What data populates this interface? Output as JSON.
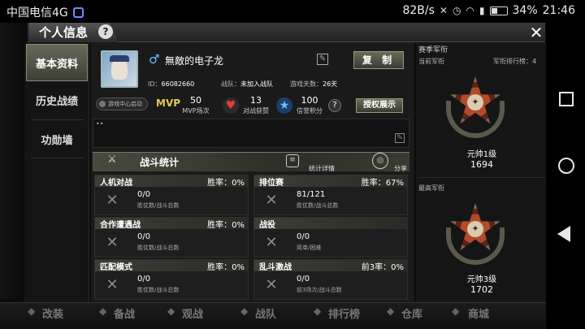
{
  "status_bar": {
    "carrier": "中国电信4G",
    "speed": "82B/s",
    "battery": "34%",
    "time": "21:46",
    "net_small": "4G"
  },
  "window": {
    "title": "个人信息",
    "help": "?",
    "close": "✕"
  },
  "side_menu": {
    "items": [
      {
        "label": "基本资料"
      },
      {
        "label": "历史战绩"
      },
      {
        "label": "功勋墙"
      }
    ]
  },
  "profile": {
    "gender_icon": "♂",
    "nickname": "無敵的电子龙",
    "copy_label": "复 制",
    "id_label": "ID：",
    "id_value": "66082660",
    "team_label": "战队：",
    "team_value": "未加入战队",
    "days_label": "游戏天数：",
    "days_value": "26天",
    "live_label": "游戏中心启动",
    "mvp_badge": "MVP",
    "mvp_value": "50",
    "mvp_label": "MVP场次",
    "likes_value": "13",
    "likes_label": "对战获赞",
    "credit_value": "100",
    "credit_label": "信誉积分",
    "help": "?",
    "auth_label": "授权展示",
    "signature": "••"
  },
  "battle": {
    "title": "战斗统计",
    "detail_label": "统计详情",
    "share_label": "分享",
    "modes": [
      {
        "name": "人机对战",
        "rate": "胜率：0%",
        "value": "0/0",
        "sub": "胜仗数/战斗总数"
      },
      {
        "name": "排位赛",
        "rate": "胜率：67%",
        "value": "81/121",
        "sub": "胜仗数/战斗总数"
      },
      {
        "name": "合作遭遇战",
        "rate": "胜率：0%",
        "value": "0/0",
        "sub": "胜仗数/战斗总数"
      },
      {
        "name": "战役",
        "rate": "",
        "value": "0/0",
        "sub": "简单/困难"
      },
      {
        "name": "匹配模式",
        "rate": "胜率：0%",
        "value": "0/0",
        "sub": "胜仗数/战斗总数"
      },
      {
        "name": "乱斗激战",
        "rate": "前3率：0%",
        "value": "0/0",
        "sub": "前3场次/战斗总数"
      }
    ]
  },
  "rank_panel": {
    "season_title": "赛季军衔",
    "current_label": "当前军衔",
    "rank_board_label": "军衔排行榜：4",
    "current_rank": "元帅1级",
    "current_points": "1694",
    "highest_label": "最高军衔",
    "highest_rank": "元帅3级",
    "highest_points": "1702"
  },
  "bottom_nav": {
    "items": [
      "改装",
      "备战",
      "观战",
      "战队",
      "排行榜",
      "仓库",
      "商城"
    ]
  }
}
